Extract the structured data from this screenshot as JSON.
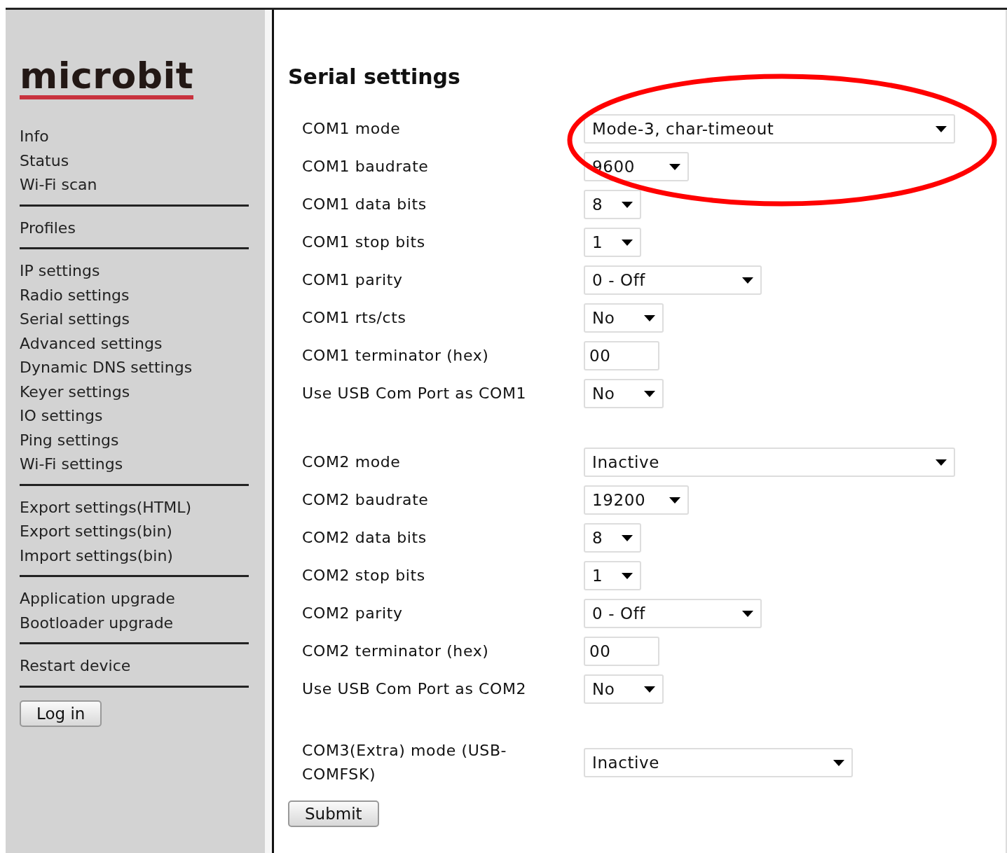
{
  "sidebar": {
    "logo": "microbit",
    "menu_groups": [
      [
        "Info",
        "Status",
        "Wi-Fi scan"
      ],
      [
        "Profiles"
      ],
      [
        "IP settings",
        "Radio settings",
        "Serial settings",
        "Advanced settings",
        "Dynamic DNS settings",
        "Keyer settings",
        "IO settings",
        "Ping settings",
        "Wi-Fi settings"
      ],
      [
        "Export settings(HTML)",
        "Export settings(bin)",
        "Import settings(bin)"
      ],
      [
        "Application upgrade",
        "Bootloader upgrade"
      ],
      [
        "Restart device"
      ]
    ],
    "login_button": "Log in"
  },
  "main": {
    "title": "Serial settings",
    "groups": [
      {
        "fields": [
          {
            "label": "COM1 mode",
            "kind": "select",
            "value": "Mode-3, char-timeout"
          },
          {
            "label": "COM1 baudrate",
            "kind": "select",
            "value": "9600"
          },
          {
            "label": "COM1 data bits",
            "kind": "select",
            "value": "8"
          },
          {
            "label": "COM1 stop bits",
            "kind": "select",
            "value": "1"
          },
          {
            "label": "COM1 parity",
            "kind": "select",
            "value": "0 - Off"
          },
          {
            "label": "COM1 rts/cts",
            "kind": "select",
            "value": "No"
          },
          {
            "label": "COM1 terminator (hex)",
            "kind": "text",
            "value": "00"
          },
          {
            "label": "Use USB Com Port as COM1",
            "kind": "select",
            "value": "No"
          }
        ]
      },
      {
        "fields": [
          {
            "label": "COM2 mode",
            "kind": "select",
            "value": "Inactive"
          },
          {
            "label": "COM2 baudrate",
            "kind": "select",
            "value": "19200"
          },
          {
            "label": "COM2 data bits",
            "kind": "select",
            "value": "8"
          },
          {
            "label": "COM2 stop bits",
            "kind": "select",
            "value": "1"
          },
          {
            "label": "COM2 parity",
            "kind": "select",
            "value": "0 - Off"
          },
          {
            "label": "COM2 terminator (hex)",
            "kind": "text",
            "value": "00"
          },
          {
            "label": "Use USB Com Port as COM2",
            "kind": "select",
            "value": "No"
          }
        ]
      },
      {
        "fields": [
          {
            "label": "COM3(Extra) mode (USB-COMFSK)",
            "kind": "select",
            "value": "Inactive"
          }
        ]
      }
    ],
    "submit_button": "Submit"
  }
}
